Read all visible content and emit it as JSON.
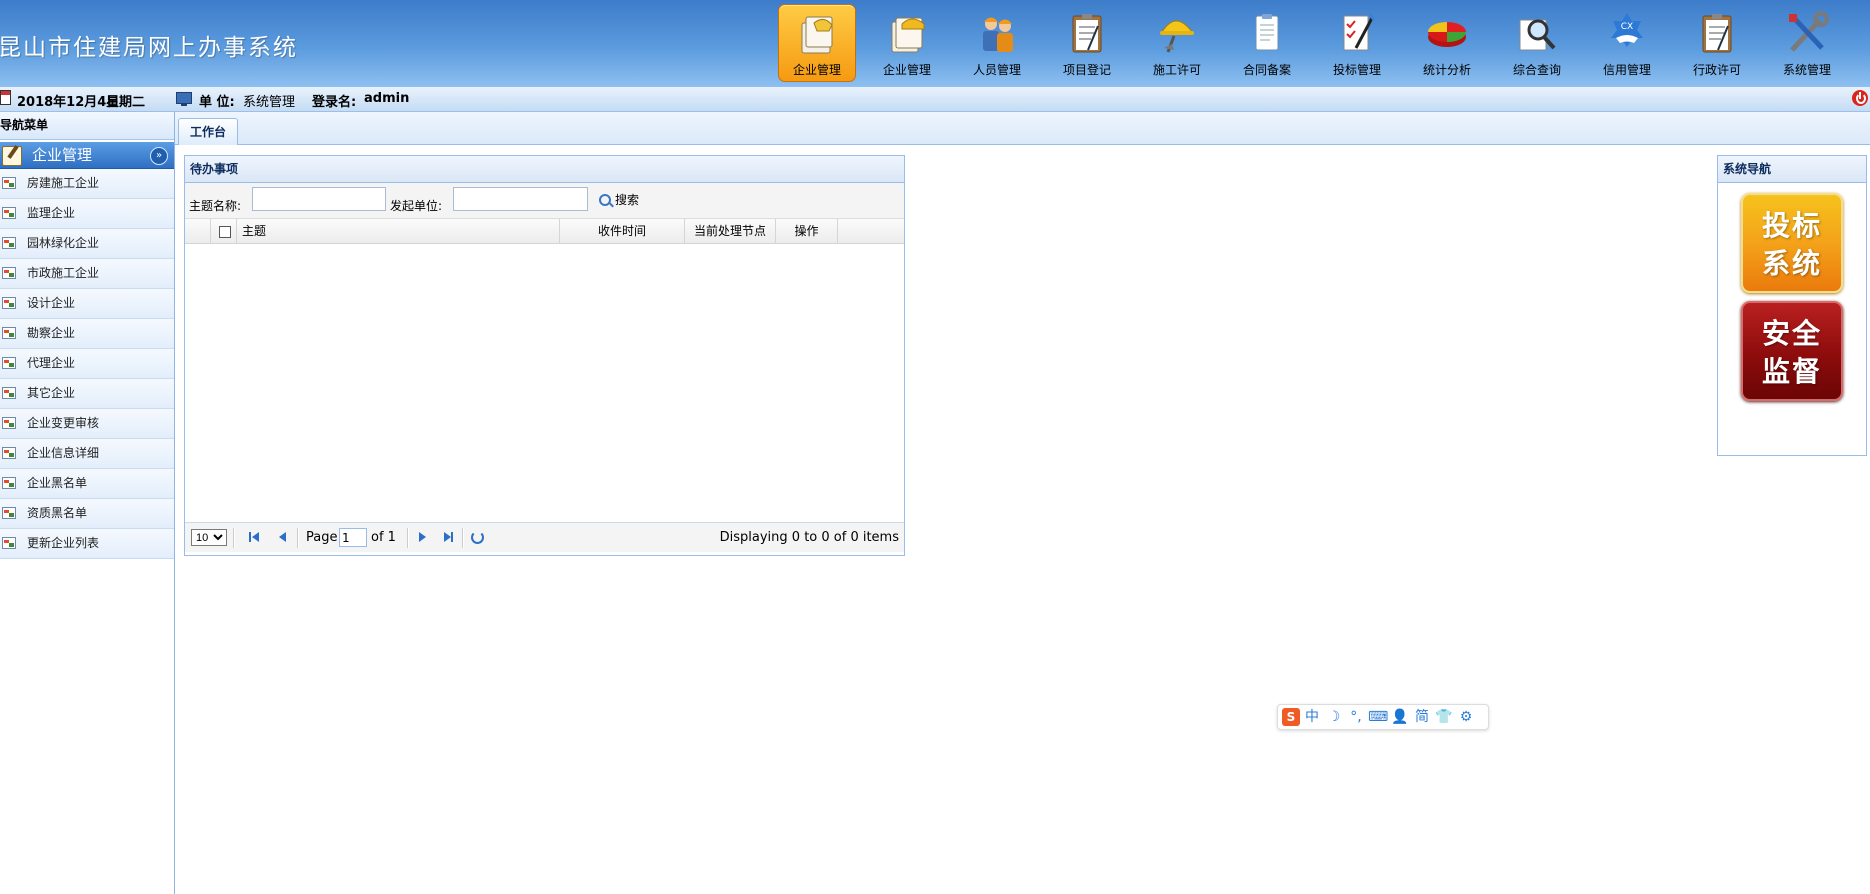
{
  "app": {
    "title": "昆山市住建局网上办事系统"
  },
  "topnav": [
    {
      "label": "企业管理",
      "icon": "enterprise-folder-icon",
      "active": true
    },
    {
      "label": "企业管理",
      "icon": "enterprise-helmet-icon"
    },
    {
      "label": "人员管理",
      "icon": "workers-icon"
    },
    {
      "label": "项目登记",
      "icon": "clipboard-icon"
    },
    {
      "label": "施工许可",
      "icon": "construction-helmet-icon"
    },
    {
      "label": "合同备案",
      "icon": "contract-document-icon"
    },
    {
      "label": "投标管理",
      "icon": "bidding-checklist-icon"
    },
    {
      "label": "统计分析",
      "icon": "pie-chart-icon"
    },
    {
      "label": "综合查询",
      "icon": "magnifier-icon"
    },
    {
      "label": "信用管理",
      "icon": "credit-handshake-icon"
    },
    {
      "label": "行政许可",
      "icon": "permit-clipboard-icon"
    },
    {
      "label": "系统管理",
      "icon": "tools-icon"
    }
  ],
  "statusbar": {
    "date": "2018年12月4日",
    "weekday": "星期二",
    "unit_label": "单 位:",
    "unit_value": "系统管理",
    "login_label": "登录名:",
    "login_value": "admin"
  },
  "sidebar": {
    "title": "导航菜单",
    "group": "企业管理",
    "items": [
      {
        "label": "房建施工企业"
      },
      {
        "label": "监理企业"
      },
      {
        "label": "园林绿化企业"
      },
      {
        "label": "市政施工企业"
      },
      {
        "label": "设计企业"
      },
      {
        "label": "勘察企业"
      },
      {
        "label": "代理企业"
      },
      {
        "label": "其它企业"
      },
      {
        "label": "企业变更审核"
      },
      {
        "label": "企业信息详细"
      },
      {
        "label": "企业黑名单"
      },
      {
        "label": "资质黑名单"
      },
      {
        "label": "更新企业列表"
      }
    ]
  },
  "tabs": [
    {
      "label": "工作台"
    }
  ],
  "todo": {
    "title": "待办事项",
    "subject_label": "主题名称:",
    "subject_value": "",
    "unit_label": "发起单位:",
    "unit_value": "",
    "search_label": "搜索",
    "columns": [
      "主题",
      "收件时间",
      "当前处理节点",
      "操作"
    ],
    "rows": [],
    "pager": {
      "page_size": "10",
      "page_label": "Page",
      "page_value": "1",
      "of_label": "of 1",
      "display_text": "Displaying 0 to 0 of 0 items"
    }
  },
  "sysnav": {
    "title": "系统导航",
    "tiles": [
      {
        "line1": "投标",
        "line2": "系统",
        "color": "#f4a21a"
      },
      {
        "line1": "安全",
        "line2": "监督",
        "color": "#8d0c0c"
      }
    ]
  },
  "ime": {
    "logo": "S",
    "items": [
      "中",
      "☽",
      "°,",
      "⌨",
      "👤",
      "简",
      "👕",
      "⚙"
    ]
  },
  "colors": {
    "header": "#5b9bde",
    "active_nav": "#f59a12",
    "accent": "#2b6fc7"
  }
}
